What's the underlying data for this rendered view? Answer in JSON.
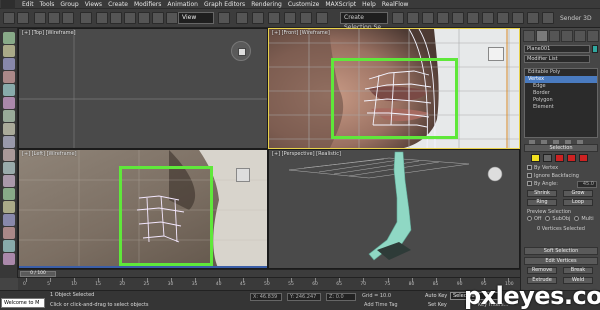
{
  "app": {
    "name": "Autodesk 3ds Max",
    "brand": "Sender 3D"
  },
  "menus": [
    "Edit",
    "Tools",
    "Group",
    "Views",
    "Create",
    "Modifiers",
    "Animation",
    "Graph Editors",
    "Rendering",
    "Customize",
    "MAXScript",
    "Help",
    "RealFlow"
  ],
  "toolbar": {
    "view_dropdown": "View",
    "named_selection": "Create Selection Se"
  },
  "viewports": {
    "top": "[+] [Top] [Wireframe]",
    "front": "[+] [Front] [Wireframe]",
    "left": "[+] [Left] [Wireframe]",
    "perspective": "[+] [Perspective] [Realistic]"
  },
  "command_panel": {
    "object_name": "Plane001",
    "modifier_list": "Modifier List",
    "stack": [
      "Editable Poly",
      "Vertex",
      "Edge",
      "Border",
      "Polygon",
      "Element"
    ],
    "stack_selected": 1,
    "selection_rollout": "Selection",
    "options": [
      "By Vertex",
      "Ignore Backfacing",
      "By Angle:"
    ],
    "by_angle_value": "45.0",
    "buttons": {
      "shrink": "Shrink",
      "grow": "Grow",
      "ring": "Ring",
      "loop": "Loop"
    },
    "preview_selection": "Preview Selection",
    "preview_opts": [
      "Off",
      "SubObj",
      "Multi"
    ],
    "selected_info": "0 Vertices Selected",
    "soft_selection": "Soft Selection",
    "edit_vertices": "Edit Vertices",
    "remove": "Remove",
    "break": "Break",
    "extrude": "Extrude",
    "weld": "Weld"
  },
  "timeline": {
    "frame": "0 / 100",
    "ticks": [
      "0",
      "5",
      "10",
      "15",
      "20",
      "25",
      "30",
      "35",
      "40",
      "45",
      "50",
      "55",
      "60",
      "65",
      "70",
      "75",
      "80",
      "85",
      "90",
      "95",
      "100"
    ]
  },
  "status": {
    "maxscript": "Welcome to M",
    "line1": "1 Object Selected",
    "line2": "Click or click-and-drag to select objects",
    "x": "X: 46.839",
    "y": "Y: 246.247",
    "z": "Z: 0.0",
    "grid": "Grid = 10.0",
    "add_time_tag": "Add Time Tag",
    "auto_key": "Auto Key",
    "set_key": "Set Key",
    "selected": "Selected",
    "key_filters": "Key Filters..."
  },
  "watermark": "pxleyes.com",
  "colors": {
    "highlight_box": "#5fe83a",
    "stack_selected": "#4a7bc0",
    "active_viewport": "#e8d24a"
  },
  "icons": [
    "select-icon",
    "move-icon",
    "rotate-icon",
    "scale-icon",
    "snap-icon",
    "render-icon",
    "teapot-icon"
  ]
}
